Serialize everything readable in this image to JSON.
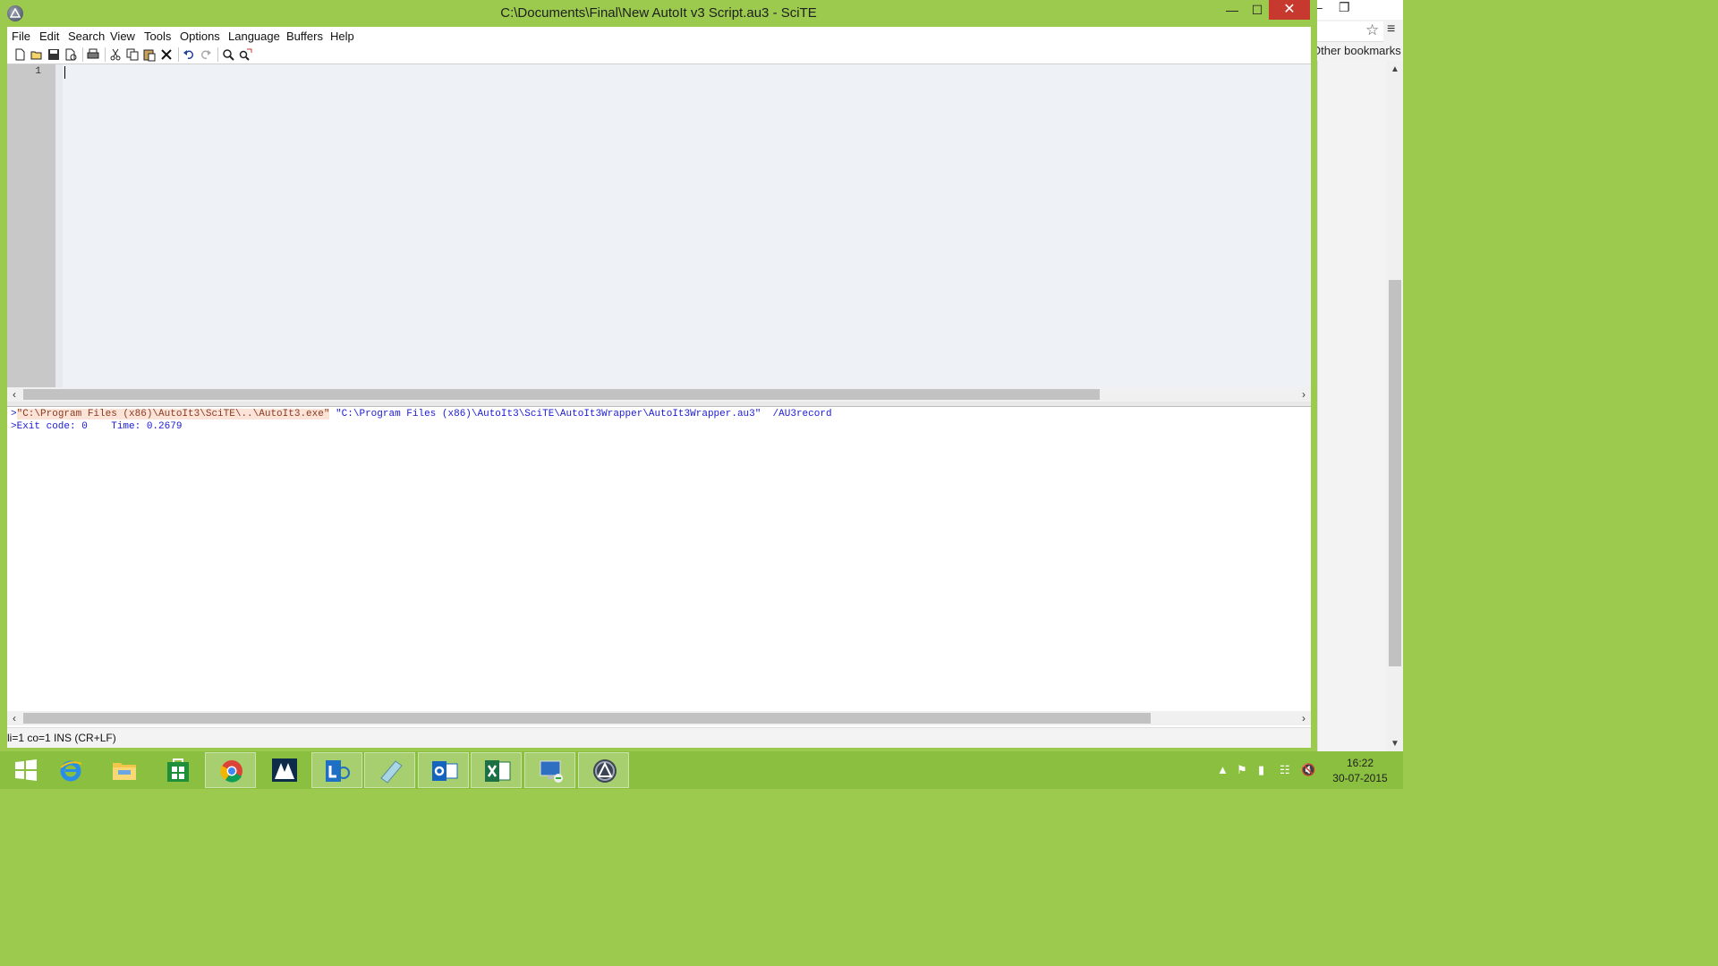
{
  "window": {
    "title": "C:\\Documents\\Final\\New AutoIt v3 Script.au3 - SciTE",
    "minimize": "—",
    "maximize": "☐",
    "close": "✕"
  },
  "menu": [
    "File",
    "Edit",
    "Search",
    "View",
    "Tools",
    "Options",
    "Language",
    "Buffers",
    "Help"
  ],
  "toolbar_icons": [
    "new-file-icon",
    "open-file-icon",
    "save-icon",
    "save-as-icon",
    "print-icon",
    "cut-icon",
    "copy-icon",
    "paste-icon",
    "delete-icon",
    "undo-icon",
    "redo-icon",
    "find-icon",
    "replace-icon"
  ],
  "editor": {
    "line_number": "1"
  },
  "output": {
    "cmd_prefix": ">",
    "cmd_path": "\"C:\\Program Files (x86)\\AutoIt3\\SciTE\\..\\AutoIt3.exe\"",
    "cmd_args": " \"C:\\Program Files (x86)\\AutoIt3\\SciTE\\AutoIt3Wrapper\\AutoIt3Wrapper.au3\"  /AU3record",
    "exit_line": ">Exit code: 0    Time: 0.2679"
  },
  "status": {
    "text": "li=1 co=1 INS (CR+LF)"
  },
  "browser": {
    "bookmarks_label": "Other bookmarks"
  },
  "taskbar": {
    "apps": [
      "start",
      "internet-explorer",
      "file-explorer",
      "store",
      "chrome",
      "dynamics",
      "lync",
      "notes",
      "outlook",
      "excel",
      "remote-desktop",
      "autoit-scite"
    ],
    "active_app": "autoit-scite",
    "time": "16:22",
    "date": "30-07-2015"
  },
  "colors": {
    "accent": "#9cca4e",
    "taskbar": "#8bbf3f",
    "close": "#c7392e",
    "editor_bg": "#eef2f7",
    "output_text": "#1a1ad6"
  }
}
